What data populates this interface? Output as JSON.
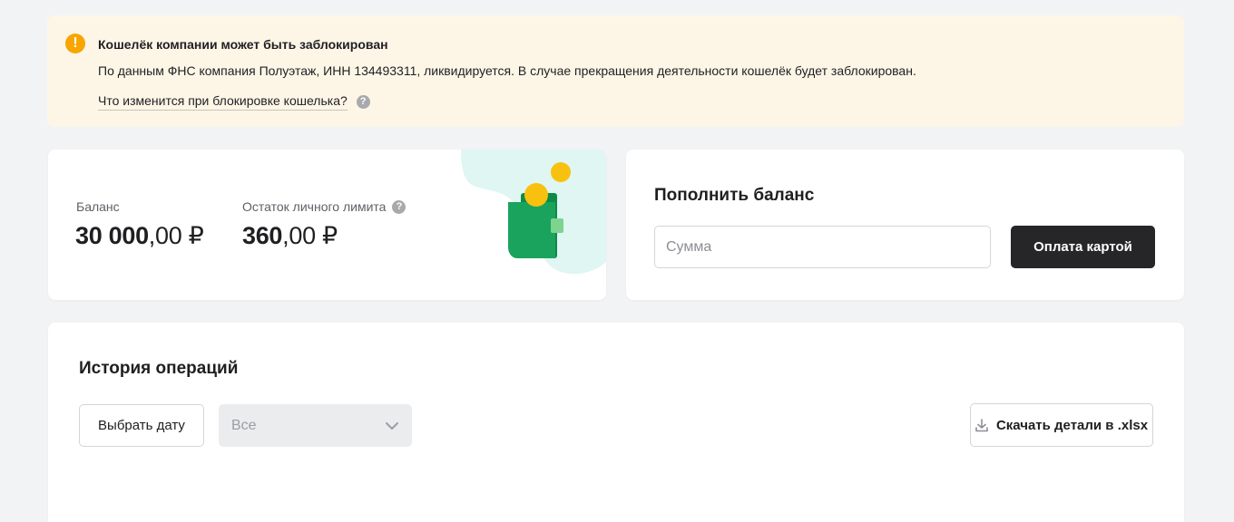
{
  "banner": {
    "title": "Кошелёк компании может быть заблокирован",
    "text": "По данным ФНС компания Полуэтаж, ИНН 134493311, ликвидируется. В случае прекращения деятельности кошелёк будет заблокирован.",
    "link": "Что изменится при блокировке кошелька?",
    "icon": "warning-icon",
    "icon_glyph": "!",
    "help_glyph": "?"
  },
  "balance": {
    "label": "Баланс",
    "amount_int": "30 000",
    "amount_frac": ",00 ₽",
    "limit_label": "Остаток личного лимита",
    "limit_int": "360",
    "limit_frac": ",00 ₽",
    "help_glyph": "?"
  },
  "topup": {
    "title": "Пополнить баланс",
    "sum_placeholder": "Сумма",
    "pay_button": "Оплата картой"
  },
  "history": {
    "title": "История операций",
    "date_button": "Выбрать дату",
    "filter_value": "Все",
    "download_button": "Скачать детали в .xlsx"
  },
  "colors": {
    "banner_bg": "#fdf6e7",
    "warning": "#f7a600",
    "dark_button": "#262628",
    "wallet_green": "#1aa35c",
    "coin_yellow": "#f8c10f",
    "art_bg": "#dff6f3"
  }
}
